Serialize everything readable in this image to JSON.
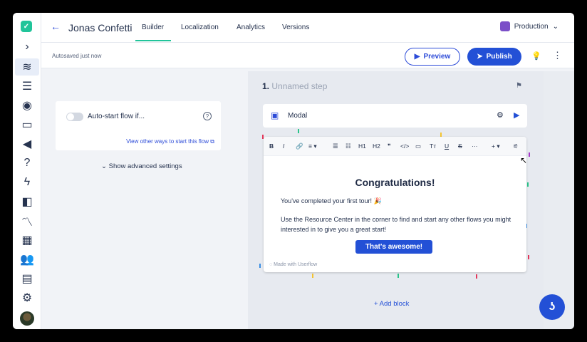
{
  "topbar": {
    "back_icon": "arrow-left-icon",
    "flow_title": "Jonas Confetti",
    "tabs": [
      {
        "label": "Builder",
        "active": true
      },
      {
        "label": "Localization"
      },
      {
        "label": "Analytics"
      },
      {
        "label": "Versions"
      }
    ],
    "environment": "Production",
    "env_color": "#7b4fc8",
    "accent_color": "#21c49a"
  },
  "subbar": {
    "autosaved": "Autosaved just now",
    "preview_label": "Preview",
    "publish_label": "Publish",
    "primary_color": "#2350d6"
  },
  "leftpanel": {
    "autostart_label": "Auto-start flow if...",
    "autostart_enabled": false,
    "other_ways": "View other ways to start this flow",
    "advanced": "Show advanced settings"
  },
  "step": {
    "number": "1.",
    "name": "Unnamed step",
    "block_type": "Modal",
    "heading": "Congratulations!",
    "paragraph1": "You've completed your first tour! 🎉",
    "paragraph2": "Use the Resource Center in the corner to find and start any other flows you might interested in to give you a great start!",
    "button_label": "That's awesome!",
    "branding": "Made with Userflow",
    "add_block": "Add block"
  },
  "toolbar": [
    "B",
    "I",
    "🔗",
    "≡ ▾",
    "☰",
    "☷",
    "H1",
    "H2",
    "❞",
    "</>",
    "▭",
    "Tт",
    "U",
    "S",
    "···",
    "+ ▾",
    "⚟"
  ],
  "nav_icons": [
    "chevron-right-icon",
    "flows-icon",
    "checklists-icon",
    "launchers-icon",
    "banners-icon",
    "announcements-icon",
    "help-icon",
    "actions-icon",
    "content-icon",
    "analytics-icon",
    "apps-icon",
    "users-icon",
    "companies-icon",
    "settings-icon"
  ]
}
